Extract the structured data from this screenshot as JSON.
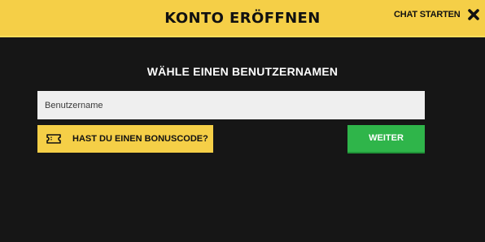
{
  "header": {
    "title": "KONTO ERÖFFNEN",
    "chat_label": "CHAT STARTEN",
    "close_icon": "close-icon"
  },
  "form": {
    "heading": "WÄHLE EINEN BENUTZERNAMEN",
    "username_placeholder": "Benutzername",
    "username_value": "",
    "bonus_label": "HAST DU EINEN BONUSCODE?",
    "bonus_icon": "ticket-icon",
    "next_label": "WEITER"
  },
  "colors": {
    "header_bg": "#f5cf47",
    "body_bg": "#161616",
    "accent_yellow": "#f5cf47",
    "next_green": "#2fb54a"
  }
}
